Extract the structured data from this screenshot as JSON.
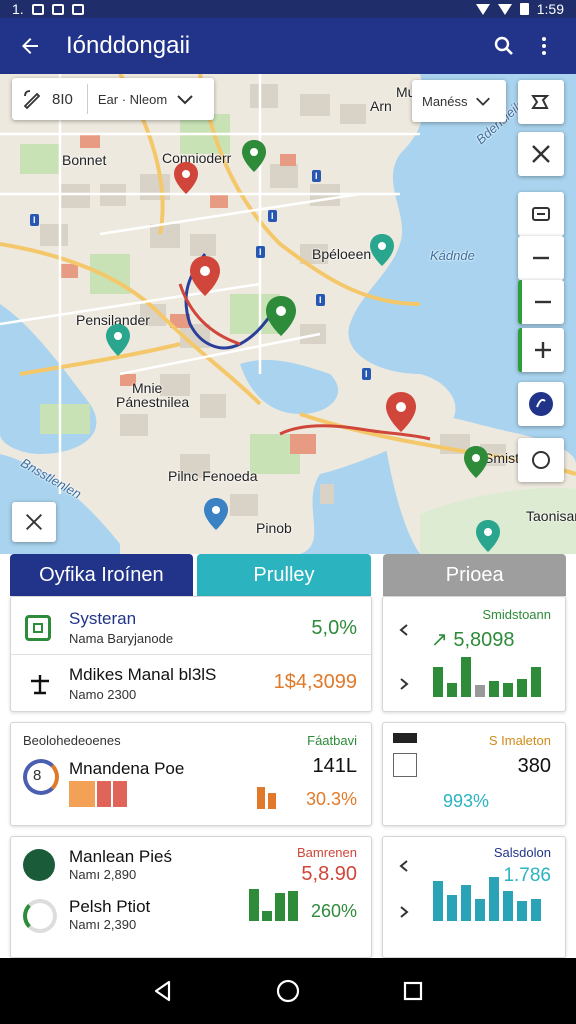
{
  "status": {
    "left": "1.",
    "time": "1:59"
  },
  "appbar": {
    "title": "Iónddongaii"
  },
  "map": {
    "chip_left_icon_label": "8I0",
    "chip_left_text": "Ear · Nleom",
    "chip_right_label": "Manéss",
    "labels": {
      "a": "Bonnet",
      "b": "Connioderr",
      "c": "Bpéloeen",
      "d": "Pensilander",
      "e": "Mnie",
      "f": "Pánestnilea",
      "g": "Pilnc Fenoeda",
      "h": "Pinob",
      "i": "Arn",
      "j": "Mutni",
      "k": "Kádnde",
      "l": "Bdensieilen",
      "m": "Smiste",
      "n": "Taonisan",
      "o": "Bnsstlenlen"
    }
  },
  "tabs": [
    "Oyfika Iroínen",
    "Prulley",
    "Prioea"
  ],
  "card1": {
    "row1": {
      "title": "Systeran",
      "sub": "Nama Baryjanode",
      "value": "5,0%"
    },
    "row2": {
      "title": "Mdikes Manal bl3lS",
      "sub": "Namo 2300",
      "value": "1$4,3099"
    }
  },
  "card2": {
    "label": "Smidstoann",
    "value": "↗ 5,8098"
  },
  "card3": {
    "header": "Beolohedeoenes",
    "title": "Mnandena Poe",
    "tag": "Fáatbavi",
    "value1": "141L",
    "value2": "30.3%"
  },
  "card4": {
    "tag": "S Imaleton",
    "value": "380",
    "pct": "993%"
  },
  "card5": {
    "row1": {
      "title": "Manlean Pieś",
      "sub": "Namı 2,890",
      "tag": "Bamrenen",
      "value": "5,8.90"
    },
    "row2": {
      "title": "Pelsh Ptiot",
      "sub": "Namı 2,390",
      "value": "260%"
    }
  },
  "card6": {
    "label": "Salsdolon",
    "value": "1.786"
  },
  "colors": {
    "primary": "#22348a",
    "teal": "#2bb3c0",
    "green": "#2e8b3a",
    "orange": "#e07a2a"
  }
}
